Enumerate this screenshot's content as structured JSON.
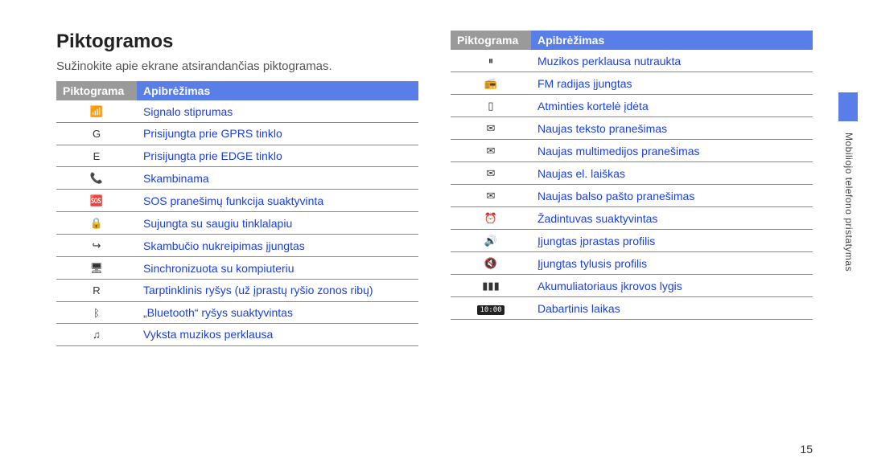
{
  "heading": "Piktogramos",
  "intro": "Sužinokite apie ekrane atsirandančias piktogramas.",
  "table_headers": {
    "icon": "Piktograma",
    "definition": "Apibrėžimas"
  },
  "left_rows": [
    {
      "icon_name": "signal-icon",
      "glyph": "📶",
      "definition": "Signalo stiprumas"
    },
    {
      "icon_name": "gprs-icon",
      "glyph": "G",
      "definition": "Prisijungta prie GPRS tinklo"
    },
    {
      "icon_name": "edge-icon",
      "glyph": "E",
      "definition": "Prisijungta prie EDGE tinklo"
    },
    {
      "icon_name": "call-icon",
      "glyph": "📞",
      "definition": "Skambinama"
    },
    {
      "icon_name": "sos-icon",
      "glyph": "🆘",
      "definition": "SOS pranešimų funkcija suaktyvinta"
    },
    {
      "icon_name": "secure-web-icon",
      "glyph": "🔒",
      "definition": "Sujungta su saugiu tinklalapiu"
    },
    {
      "icon_name": "call-forward-icon",
      "glyph": "↪",
      "definition": "Skambučio nukreipimas įjungtas"
    },
    {
      "icon_name": "pc-sync-icon",
      "glyph": "🖥",
      "definition": "Sinchronizuota su kompiuteriu"
    },
    {
      "icon_name": "roaming-icon",
      "glyph": "R",
      "definition": "Tarptinklinis ryšys (už įprastų ryšio zonos ribų)"
    },
    {
      "icon_name": "bluetooth-icon",
      "glyph": "ᛒ",
      "definition": "„Bluetooth“ ryšys suaktyvintas"
    },
    {
      "icon_name": "music-play-icon",
      "glyph": "♫",
      "definition": "Vyksta muzikos perklausa"
    }
  ],
  "right_rows": [
    {
      "icon_name": "music-pause-icon",
      "glyph": "⏸",
      "definition": "Muzikos perklausa nutraukta"
    },
    {
      "icon_name": "fm-radio-icon",
      "glyph": "📻",
      "definition": "FM radijas įjungtas"
    },
    {
      "icon_name": "memory-card-icon",
      "glyph": "▯",
      "definition": "Atminties kortelė įdėta"
    },
    {
      "icon_name": "new-text-icon",
      "glyph": "✉",
      "definition": "Naujas teksto pranešimas"
    },
    {
      "icon_name": "new-mms-icon",
      "glyph": "✉",
      "definition": "Naujas multimedijos pranešimas"
    },
    {
      "icon_name": "new-email-icon",
      "glyph": "✉",
      "definition": "Naujas el. laiškas"
    },
    {
      "icon_name": "new-voicemail-icon",
      "glyph": "✉",
      "definition": "Naujas balso pašto pranešimas"
    },
    {
      "icon_name": "alarm-icon",
      "glyph": "⏰",
      "definition": "Žadintuvas suaktyvintas"
    },
    {
      "icon_name": "normal-profile-icon",
      "glyph": "🔊",
      "definition": "Įjungtas įprastas profilis"
    },
    {
      "icon_name": "silent-profile-icon",
      "glyph": "🔇",
      "definition": "Įjungtas tylusis profilis"
    },
    {
      "icon_name": "battery-icon",
      "glyph": "▮▮▮",
      "definition": "Akumuliatoriaus įkrovos lygis"
    },
    {
      "icon_name": "clock-icon",
      "glyph": "10:00",
      "definition": "Dabartinis laikas",
      "is_time_badge": true
    }
  ],
  "side_label": "Mobiliojo telefono pristatymas",
  "page_number": "15"
}
